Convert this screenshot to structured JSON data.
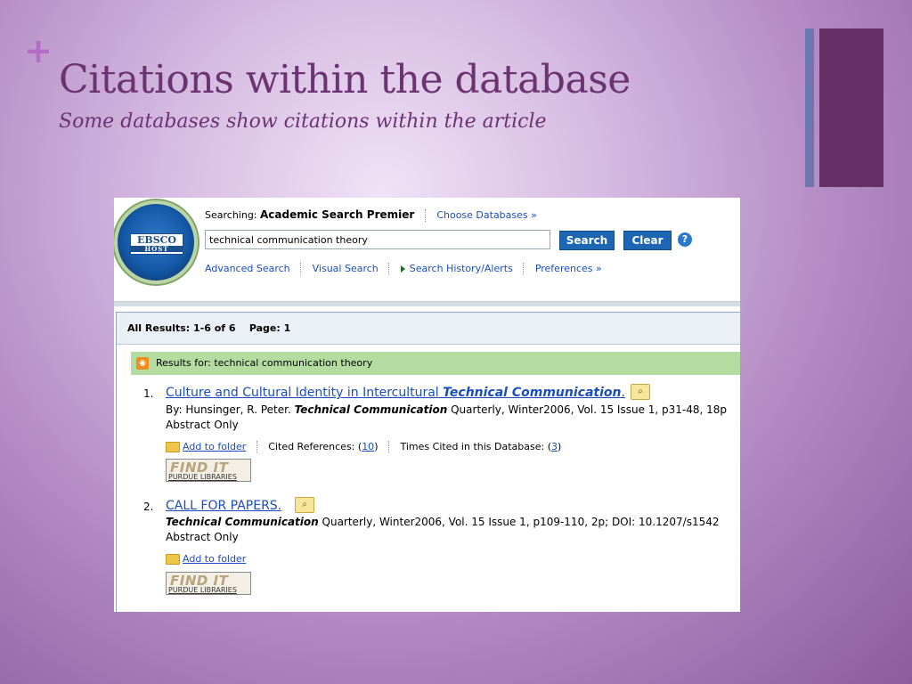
{
  "slide": {
    "plus": "+",
    "title": "Citations within the database",
    "subtitle": "Some databases show citations within the article"
  },
  "ebsco": {
    "logo_text": "EBSCO",
    "logo_sub": "HOST",
    "searching_label": "Searching:",
    "database": "Academic Search Premier",
    "choose_databases": "Choose Databases »",
    "query": "technical communication theory",
    "search_button": "Search",
    "clear_button": "Clear",
    "help": "?",
    "nav": {
      "advanced": "Advanced Search",
      "visual": "Visual Search",
      "history": "Search History/Alerts",
      "preferences": "Preferences »"
    },
    "results_header": "All Results: 1-6 of 6    Page: 1",
    "results_for": "Results for: technical communication theory",
    "results": [
      {
        "num": "1.",
        "title": "Culture and Cultural Identity in Intercultural ",
        "title_em": "Technical Communication",
        "title_end": ".",
        "byline_pre": "By: Hunsinger, R. Peter. ",
        "byline_journal": "Technical Communication",
        "byline_post": " Quarterly, Winter2006, Vol. 15 Issue 1, p31-48, 18p",
        "type": "Abstract Only",
        "add_folder": "Add to folder",
        "cited_refs_label": "Cited References: (",
        "cited_refs_count": "10",
        "cited_refs_close": ")",
        "times_cited_label": "Times Cited in this Database: (",
        "times_cited_count": "3",
        "times_cited_close": ")",
        "findit": "FIND IT",
        "findit_sub": "PURDUE LIBRARIES"
      },
      {
        "num": "2.",
        "title": "CALL FOR PAPERS.",
        "byline_journal": "Technical Communication",
        "byline_post": " Quarterly, Winter2006, Vol. 15 Issue 1, p109-110, 2p; DOI: 10.1207/s1542",
        "type": "Abstract Only",
        "add_folder": "Add to folder",
        "findit": "FIND IT",
        "findit_sub": "PURDUE LIBRARIES"
      }
    ]
  }
}
